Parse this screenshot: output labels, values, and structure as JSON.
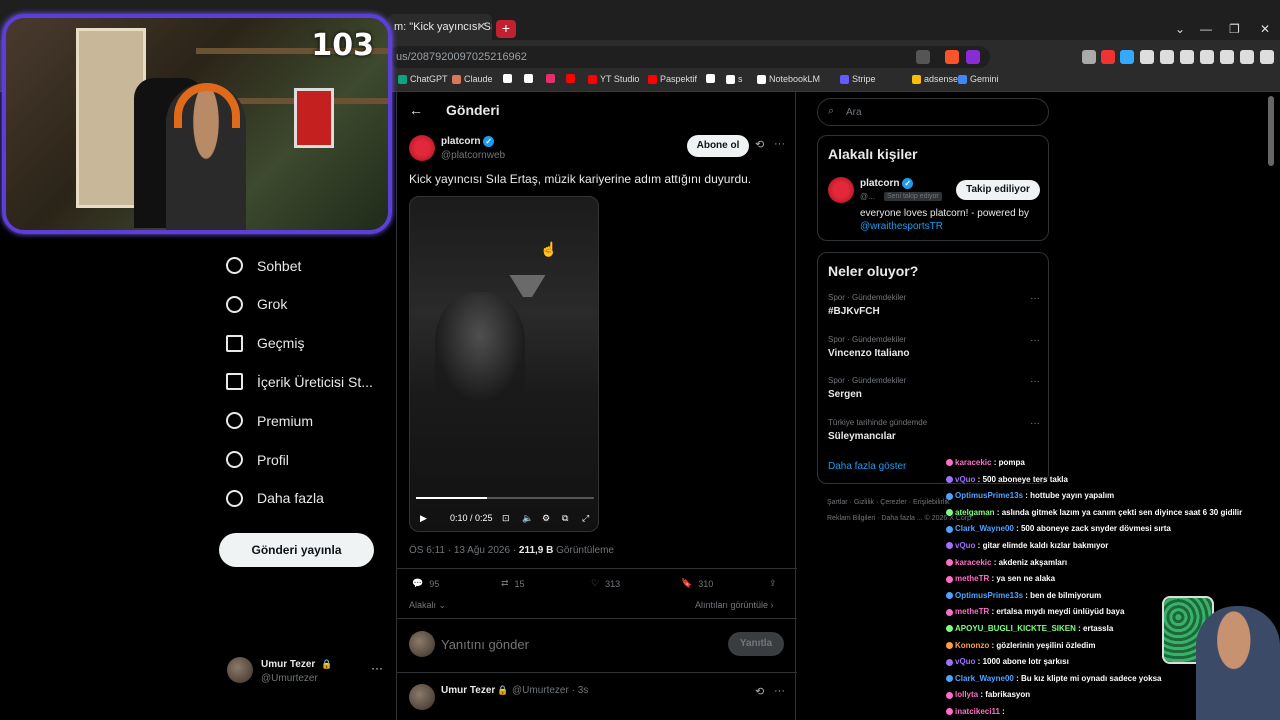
{
  "browser": {
    "tab_title": "m: \"Kick yayıncısı Sıla",
    "url": "us/2087920097025216962",
    "bookmarks": [
      {
        "label": "ChatGPT",
        "color": "#10a37f"
      },
      {
        "label": "Claude",
        "color": "#d97757"
      },
      {
        "label": "",
        "color": "#ffffff"
      },
      {
        "label": "",
        "color": "#ffffff"
      },
      {
        "label": "",
        "color": "#e1306c"
      },
      {
        "label": "",
        "color": "#ff0000"
      },
      {
        "label": "YT Studio",
        "color": "#ff0000"
      },
      {
        "label": "Paspektif",
        "color": "#ff0000"
      },
      {
        "label": "",
        "color": "#ffffff"
      },
      {
        "label": "s",
        "color": "#ffffff"
      },
      {
        "label": "NotebookLM",
        "color": "#ffffff"
      },
      {
        "label": "Stripe",
        "color": "#635bff"
      },
      {
        "label": "adsense",
        "color": "#fbbc04"
      },
      {
        "label": "Gemini",
        "color": "#4285f4"
      }
    ]
  },
  "webcam": {
    "counter": "103"
  },
  "nav": {
    "items": [
      {
        "label": "Sohbet",
        "icon": "chat-bubble-icon"
      },
      {
        "label": "Grok",
        "icon": "grok-icon"
      },
      {
        "label": "Geçmiş",
        "icon": "bookmark-icon"
      },
      {
        "label": "İçerik Üreticisi St...",
        "icon": "rocket-icon"
      },
      {
        "label": "Premium",
        "icon": "verified-badge-icon"
      },
      {
        "label": "Profil",
        "icon": "person-icon"
      },
      {
        "label": "Daha fazla",
        "icon": "more-circle-icon"
      }
    ],
    "post_button": "Gönderi yayınla",
    "account": {
      "name": "Umur Tezer",
      "handle": "@Umurtezer"
    }
  },
  "post": {
    "header_title": "Gönderi",
    "author_name": "platcorn",
    "author_handle": "@platcornweb",
    "follow_label": "Abone ol",
    "text": "Kick yayıncısı Sıla Ertaş, müzik kariyerine adım attığını duyurdu.",
    "video_time": "0:10 / 0:25",
    "video_progress": 0.4,
    "timestamp": "ÖS 6:11 · 13 Ağu 2026 ·",
    "views_count": "211,9 B",
    "views_label": "Görüntüleme",
    "replies": "95",
    "reposts": "15",
    "likes": "313",
    "bookmarks": "310",
    "relevant_label": "Alakalı",
    "quotes_label": "Alıntıları görüntüle",
    "reply_placeholder": "Yanıtını gönder",
    "reply_button": "Yanıtla",
    "reply_author": "Umur Tezer",
    "reply_handle": "@Umurtezer · 3s"
  },
  "sidebar": {
    "search_placeholder": "Ara",
    "relevant_title": "Alakalı kişiler",
    "person_name": "platcorn",
    "person_handle": "@...",
    "person_follows_you": "Seni takip ediyor",
    "following_label": "Takip ediliyor",
    "person_bio": "everyone loves platcorn! - powered by",
    "person_bio_link": "@wraithesportsTR",
    "trends_title": "Neler oluyor?",
    "trends": [
      {
        "category": "Spor · Gündemdekiler",
        "name": "#BJKvFCH"
      },
      {
        "category": "Spor · Gündemdekiler",
        "name": "Vincenzo Italiano"
      },
      {
        "category": "Spor · Gündemdekiler",
        "name": "Sergen"
      },
      {
        "category": "Türkiye tarihinde gündemde",
        "name": "Süleymancılar"
      }
    ],
    "show_more": "Daha fazla göster",
    "footer_line1": "Şartlar · Gizlilik · Çerezler · Erişilebilirlik",
    "footer_line2": "Reklam Bilgileri · Daha fazla ... © 2026 X Corp."
  },
  "chat": [
    {
      "user": "karacekic",
      "text": "pompa",
      "color": "#ff6ec7"
    },
    {
      "user": "vQuo",
      "text": "500 aboneye ters takla",
      "color": "#a070ff"
    },
    {
      "user": "OptimusPrime13s",
      "text": "hottube yayın yapalım",
      "color": "#4fa3ff"
    },
    {
      "user": "atelgaman",
      "text": "aslında gitmek lazım ya canım çekti sen diyince saat 6 30 gidilir",
      "color": "#7dff7d"
    },
    {
      "user": "Clark_Wayne00",
      "text": "500 aboneye zack snyder dövmesi sırta",
      "color": "#4fa3ff"
    },
    {
      "user": "vQuo",
      "text": "gitar elimde kaldı kızlar bakmıyor",
      "color": "#a070ff"
    },
    {
      "user": "karacekic",
      "text": "akdeniz akşamları",
      "color": "#ff6ec7"
    },
    {
      "user": "metheTR",
      "text": "ya sen ne alaka",
      "color": "#ff6ec7"
    },
    {
      "user": "OptimusPrime13s",
      "text": "ben de bilmiyorum",
      "color": "#4fa3ff"
    },
    {
      "user": "metheTR",
      "text": "ertalsa mıydı meydi ünlüyüd baya",
      "color": "#ff6ec7"
    },
    {
      "user": "APOYU_BUGLI_KICKTE_SIKEN",
      "text": "ertassla",
      "color": "#7dff7d"
    },
    {
      "user": "Kononzo",
      "text": "gözlerinin yeşilini özledim",
      "color": "#ff9f40"
    },
    {
      "user": "vQuo",
      "text": "1000 abone lotr şarkısı",
      "color": "#a070ff"
    },
    {
      "user": "Clark_Wayne00",
      "text": "Bu kız klipte mi oynadı sadece yoksa",
      "color": "#4fa3ff"
    },
    {
      "user": "lollyta",
      "text": "fabrikasyon",
      "color": "#ff6ec7"
    },
    {
      "user": "inatcikeci11",
      "text": "",
      "color": "#ff6ec7"
    }
  ]
}
